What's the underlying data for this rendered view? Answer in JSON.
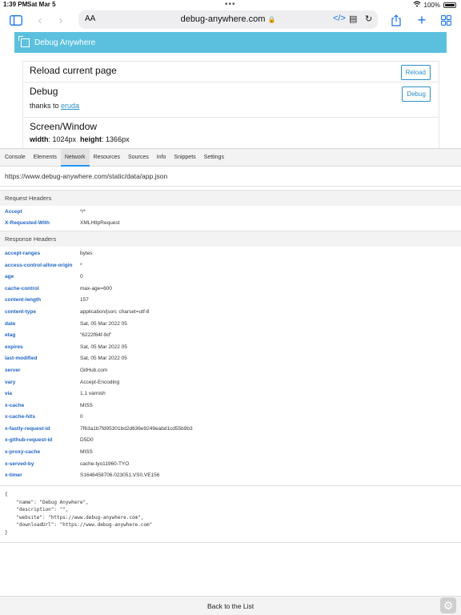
{
  "status_bar": {
    "time": "1:39 PM",
    "date": "Sat Mar 5",
    "battery": "100%"
  },
  "toolbar": {
    "text_size_label": "AA",
    "url": "debug-anywhere.com"
  },
  "page": {
    "header_title": "Debug Anywhere",
    "cards": [
      {
        "title": "Reload current page",
        "button": "Reload"
      },
      {
        "title": "Debug",
        "button": "Debug",
        "thanks_prefix": "thanks to ",
        "thanks_link": "eruda"
      },
      {
        "title": "Screen/Window",
        "width_label": "width",
        "width_value": ": 1024px",
        "height_label": "height",
        "height_value": ": 1366px"
      }
    ]
  },
  "devtools": {
    "tabs": [
      "Console",
      "Elements",
      "Network",
      "Resources",
      "Sources",
      "Info",
      "Snippets",
      "Settings"
    ],
    "active_tab": "Network",
    "request_url": "https://www.debug-anywhere.com/static/data/app.json",
    "request_headers_title": "Request Headers",
    "request_headers": [
      {
        "k": "Accept",
        "v": "*/*"
      },
      {
        "k": "X-Requested-With",
        "v": "XMLHttpRequest"
      }
    ],
    "response_headers_title": "Response Headers",
    "response_headers": [
      {
        "k": "accept-ranges",
        "v": "bytes"
      },
      {
        "k": "access-control-allow-origin",
        "v": "*"
      },
      {
        "k": "age",
        "v": "0"
      },
      {
        "k": "cache-control",
        "v": "max-age=600"
      },
      {
        "k": "content-length",
        "v": "157"
      },
      {
        "k": "content-type",
        "v": "application/json; charset=utf-8"
      },
      {
        "k": "date",
        "v": "Sat, 05 Mar 2022 05"
      },
      {
        "k": "etag",
        "v": "\"6222f64f-9d\""
      },
      {
        "k": "expires",
        "v": "Sat, 05 Mar 2022 05"
      },
      {
        "k": "last-modified",
        "v": "Sat, 05 Mar 2022 05"
      },
      {
        "k": "server",
        "v": "GitHub.com"
      },
      {
        "k": "vary",
        "v": "Accept-Encoding"
      },
      {
        "k": "via",
        "v": "1.1 varnish"
      },
      {
        "k": "x-cache",
        "v": "MISS"
      },
      {
        "k": "x-cache-hits",
        "v": "0"
      },
      {
        "k": "x-fastly-request-id",
        "v": "7f63a1b7fd95301bd2d636e9249eabd1cd55b9b3"
      },
      {
        "k": "x-github-request-id",
        "v": "D5D0"
      },
      {
        "k": "x-proxy-cache",
        "v": "MISS"
      },
      {
        "k": "x-served-by",
        "v": "cache-tyo11960-TYO"
      },
      {
        "k": "x-timer",
        "v": "S1646458706.023051,VS0,VE156"
      }
    ],
    "response_body": "{\n    \"name\": \"Debug Anywhere\",\n    \"description\": \"\",\n    \"website\": \"https://www.debug-anywhere.com\",\n    \"downloadUrl\": \"https://www.debug-anywhere.com\"\n}",
    "back_label": "Back to the List"
  }
}
